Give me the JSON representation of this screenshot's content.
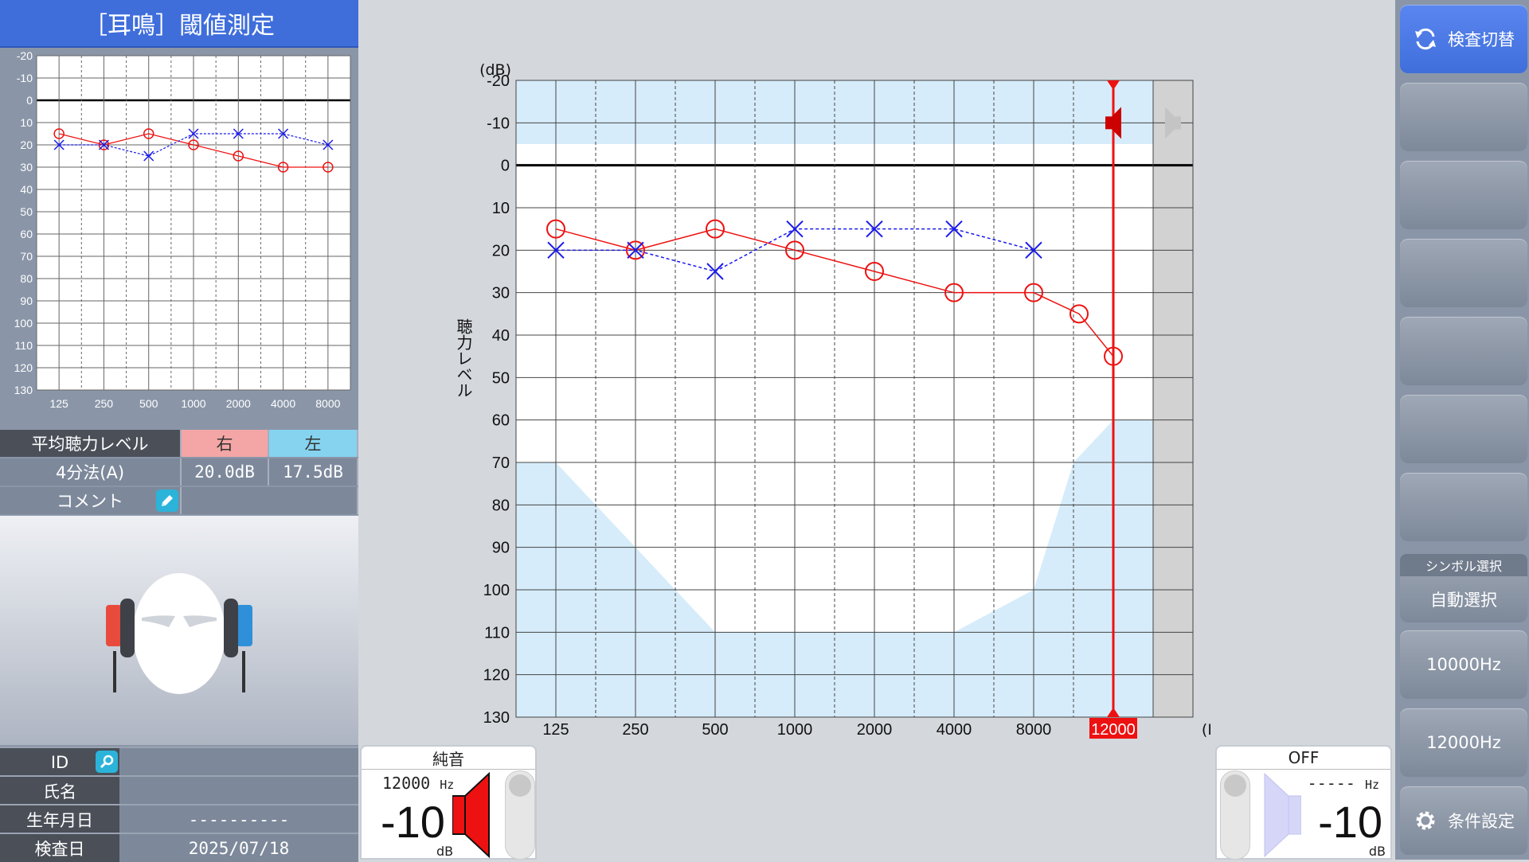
{
  "header": {
    "title": "［耳鳴］閾値測定"
  },
  "mini_audiogram": {
    "y_ticks": [
      "-20",
      "-10",
      "0",
      "10",
      "20",
      "30",
      "40",
      "50",
      "60",
      "70",
      "80",
      "90",
      "100",
      "110",
      "120",
      "130"
    ],
    "x_ticks": [
      "125",
      "250",
      "500",
      "1000",
      "2000",
      "4000",
      "8000"
    ]
  },
  "average": {
    "label": "平均聴力レベル",
    "right_header": "右",
    "left_header": "左",
    "method": "4分法(A)",
    "right_value": "20.0dB",
    "left_value": "17.5dB",
    "right_color": "#f4a6a6",
    "left_color": "#86d3f0"
  },
  "comment": {
    "label": "コメント",
    "edit_icon": "pencil-icon"
  },
  "patient": {
    "id_label": "ID",
    "id_value": "",
    "name_label": "氏名",
    "name_value": "",
    "dob_label": "生年月日",
    "dob_value": "----------",
    "exam_date_label": "検査日",
    "exam_date_value": "2025/07/18"
  },
  "chart_data": {
    "type": "line",
    "ylabel": "聴力レベル",
    "y_unit": "(dB)",
    "x_unit": "(Hz)",
    "categories": [
      "125",
      "250",
      "500",
      "1000",
      "2000",
      "4000",
      "8000",
      "12000"
    ],
    "x_tick_labels": [
      "125",
      "250",
      "500",
      "1000",
      "2000",
      "4000",
      "8000",
      "12000"
    ],
    "y_ticks": [
      -20,
      -10,
      0,
      10,
      20,
      30,
      40,
      50,
      60,
      70,
      80,
      90,
      100,
      110,
      120,
      130
    ],
    "ylim": [
      -20,
      130
    ],
    "y_inverted": true,
    "grid": true,
    "selected_frequency": "12000",
    "series": [
      {
        "color": "#ee1111",
        "symbol": "circle",
        "x": [
          "125",
          "250",
          "500",
          "1000",
          "2000",
          "4000",
          "8000",
          "10000",
          "12000"
        ],
        "values": [
          15,
          20,
          15,
          20,
          25,
          30,
          30,
          35,
          45
        ]
      },
      {
        "color": "#1a1aee",
        "symbol": "cross",
        "x": [
          "125",
          "250",
          "500",
          "1000",
          "2000",
          "4000",
          "8000"
        ],
        "values": [
          20,
          20,
          25,
          15,
          15,
          15,
          20
        ]
      }
    ],
    "shade_color": "#d6ecfa"
  },
  "outputs": {
    "right": {
      "mode": "純音",
      "freq": "12000",
      "freq_unit": "Hz",
      "level": "-10",
      "level_unit": "dB",
      "color": "#ee1111"
    },
    "left": {
      "mode": "OFF",
      "freq": "-----",
      "freq_unit": "Hz",
      "level": "-10",
      "level_unit": "dB",
      "color": "#c8c8f4"
    }
  },
  "sidebar": {
    "switch_exam": "検査切替",
    "symbol_select_title": "シンボル選択",
    "symbol_select_value": "自動選択",
    "freq1": "10000Hz",
    "freq2": "12000Hz",
    "settings": "条件設定"
  }
}
